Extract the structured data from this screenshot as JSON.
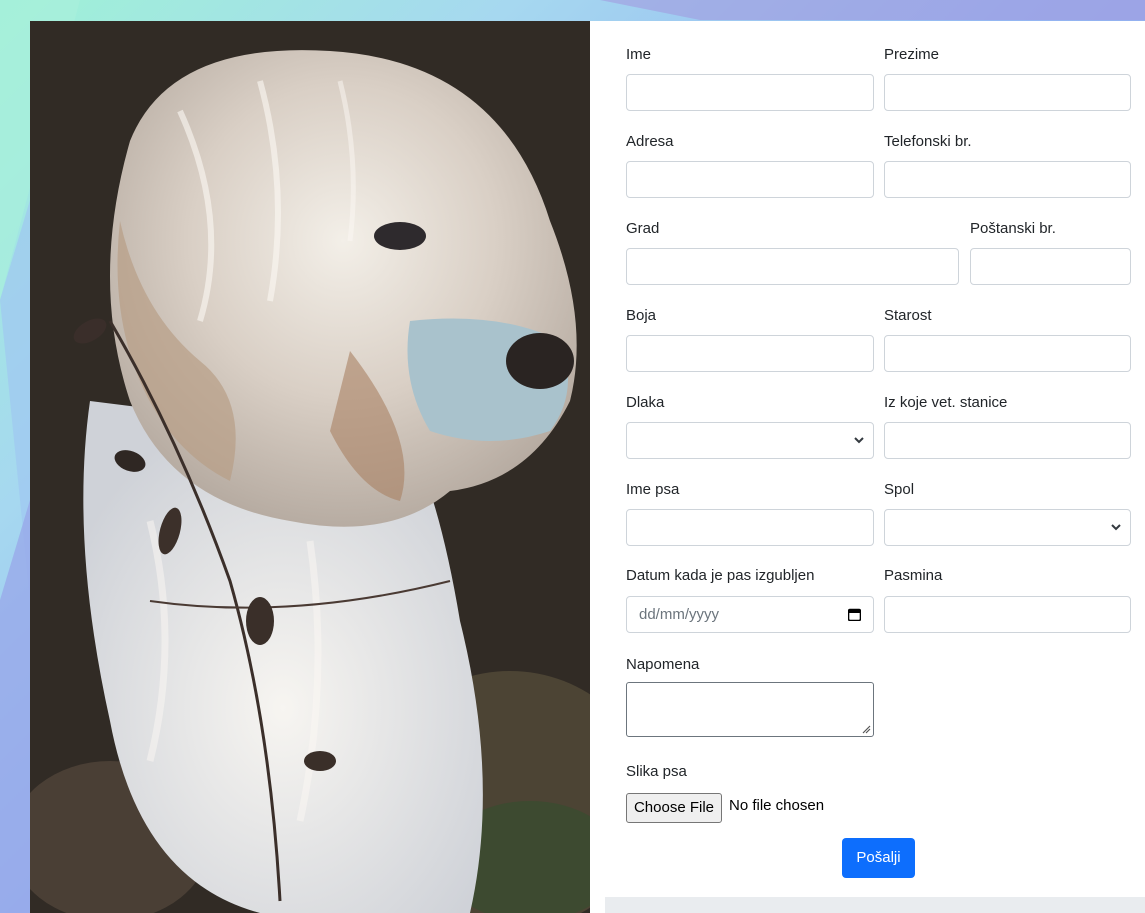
{
  "form": {
    "fields": {
      "ime": {
        "label": "Ime",
        "value": ""
      },
      "prezime": {
        "label": "Prezime",
        "value": ""
      },
      "adresa": {
        "label": "Adresa",
        "value": ""
      },
      "telefon": {
        "label": "Telefonski br.",
        "value": ""
      },
      "grad": {
        "label": "Grad",
        "value": ""
      },
      "postanski": {
        "label": "Poštanski br.",
        "value": ""
      },
      "boja": {
        "label": "Boja",
        "value": ""
      },
      "starost": {
        "label": "Starost",
        "value": ""
      },
      "dlaka": {
        "label": "Dlaka",
        "value": ""
      },
      "vet_stanica": {
        "label": "Iz koje vet. stanice",
        "value": ""
      },
      "ime_psa": {
        "label": "Ime psa",
        "value": ""
      },
      "spol": {
        "label": "Spol",
        "value": ""
      },
      "datum": {
        "label": "Datum kada je pas izgubljen",
        "placeholder": "dd/mm/yyyy"
      },
      "pasmina": {
        "label": "Pasmina",
        "value": ""
      },
      "napomena": {
        "label": "Napomena",
        "value": ""
      },
      "slika": {
        "label": "Slika psa",
        "button": "Choose File",
        "status": "No file chosen"
      }
    },
    "submit_label": "Pošalji"
  },
  "colors": {
    "primary": "#0d6efd",
    "border": "#ced4da"
  },
  "icons": {
    "select": "chevron-down-icon",
    "date": "calendar-icon"
  }
}
